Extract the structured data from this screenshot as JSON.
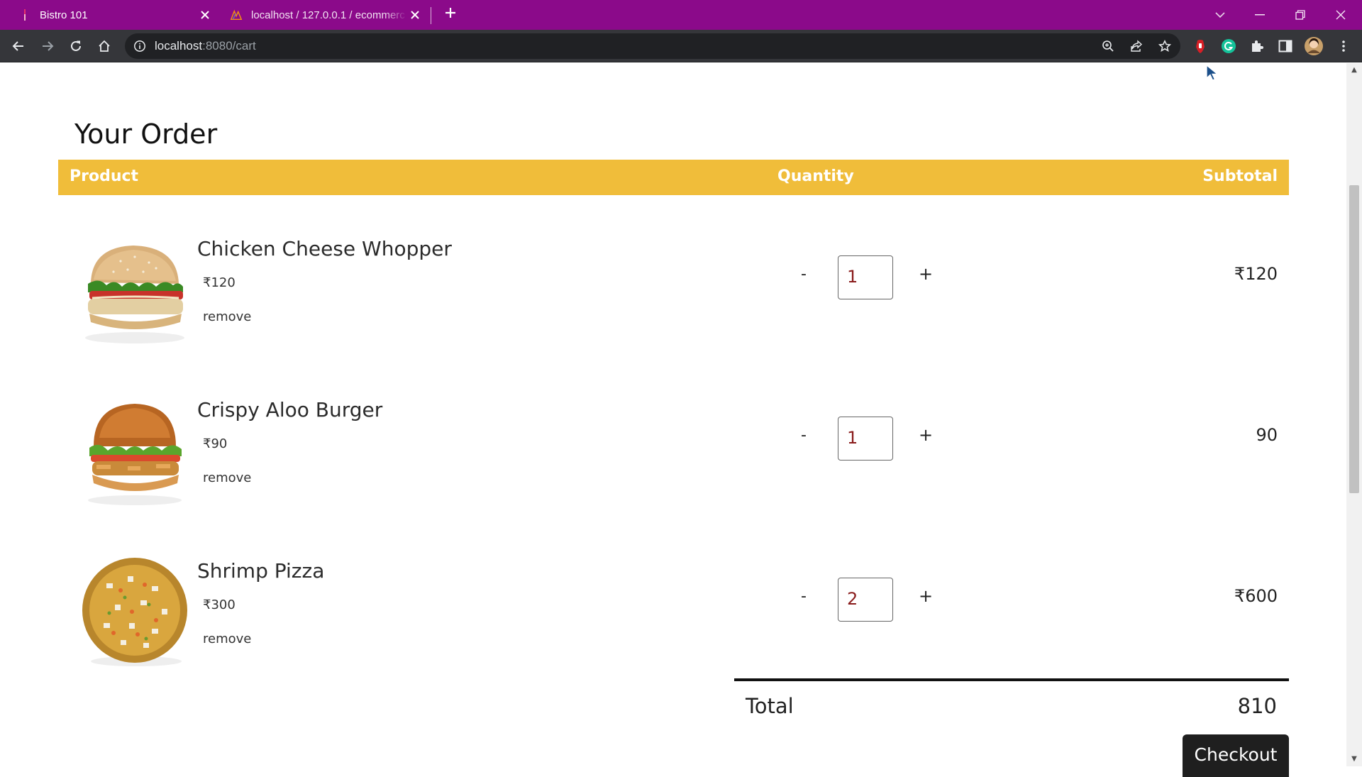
{
  "browser": {
    "tabs": [
      {
        "title": "Bistro 101",
        "active": true
      },
      {
        "title": "localhost / 127.0.0.1 / ecommerc",
        "active": false
      }
    ],
    "url_host": "localhost",
    "url_rest": ":8080/cart"
  },
  "page": {
    "title": "Your Order",
    "headers": {
      "product": "Product",
      "quantity": "Quantity",
      "subtotal": "Subtotal"
    },
    "items": [
      {
        "name": "Chicken Cheese Whopper",
        "price": "₹120",
        "remove": "remove",
        "minus": "-",
        "qty": "1",
        "plus": "+",
        "subtotal": "₹120"
      },
      {
        "name": "Crispy Aloo Burger",
        "price": "₹90",
        "remove": "remove",
        "minus": "-",
        "qty": "1",
        "plus": "+",
        "subtotal": "90"
      },
      {
        "name": "Shrimp Pizza",
        "price": "₹300",
        "remove": "remove",
        "minus": "-",
        "qty": "2",
        "plus": "+",
        "subtotal": "₹600"
      }
    ],
    "total_label": "Total",
    "total_value": "810",
    "checkout_label": "Checkout"
  },
  "colors": {
    "tabstrip": "#8b0a8a",
    "toolbar": "#35363a",
    "header_bar": "#f0bd3a",
    "checkout_bg": "#1f1f1f"
  }
}
